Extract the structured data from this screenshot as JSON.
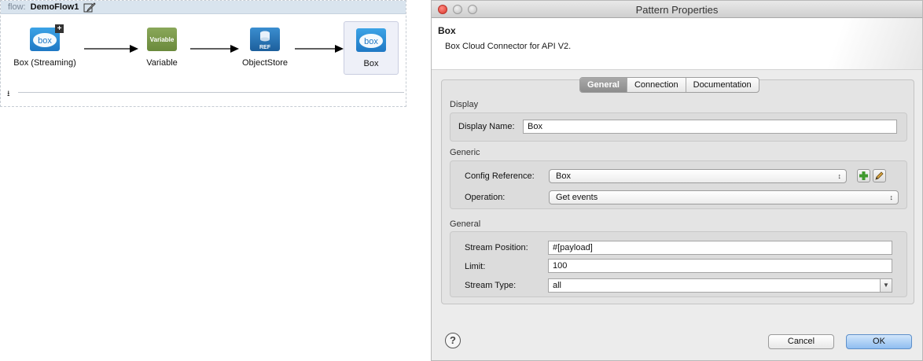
{
  "flow": {
    "keyword": "flow:",
    "name": "DemoFlow1",
    "nodes": [
      {
        "label": "Box (Streaming)",
        "icon": "box-streaming-icon",
        "icon_text": "box"
      },
      {
        "label": "Variable",
        "icon": "variable-icon",
        "icon_text": "Variable"
      },
      {
        "label": "ObjectStore",
        "icon": "objectstore-icon",
        "icon_text": "REF"
      },
      {
        "label": "Box",
        "icon": "box-icon",
        "icon_text": "box",
        "selected": true
      }
    ]
  },
  "dialog": {
    "title": "Pattern Properties",
    "banner_title": "Box",
    "banner_description": "Box Cloud Connector for API V2.",
    "tabs": [
      {
        "label": "General",
        "active": true
      },
      {
        "label": "Connection",
        "active": false
      },
      {
        "label": "Documentation",
        "active": false
      }
    ],
    "display": {
      "section": "Display",
      "name_label": "Display Name:",
      "name_value": "Box"
    },
    "generic": {
      "section": "Generic",
      "config_label": "Config Reference:",
      "config_value": "Box",
      "operation_label": "Operation:",
      "operation_value": "Get events"
    },
    "general": {
      "section": "General",
      "stream_position_label": "Stream Position:",
      "stream_position_value": "#[payload]",
      "limit_label": "Limit:",
      "limit_value": "100",
      "stream_type_label": "Stream Type:",
      "stream_type_value": "all"
    },
    "help": "?",
    "cancel_label": "Cancel",
    "ok_label": "OK"
  },
  "colors": {
    "ok_button": "#8fbdf0",
    "flow_header": "#d9e4ee",
    "active_tab": "#8c8c8c"
  }
}
